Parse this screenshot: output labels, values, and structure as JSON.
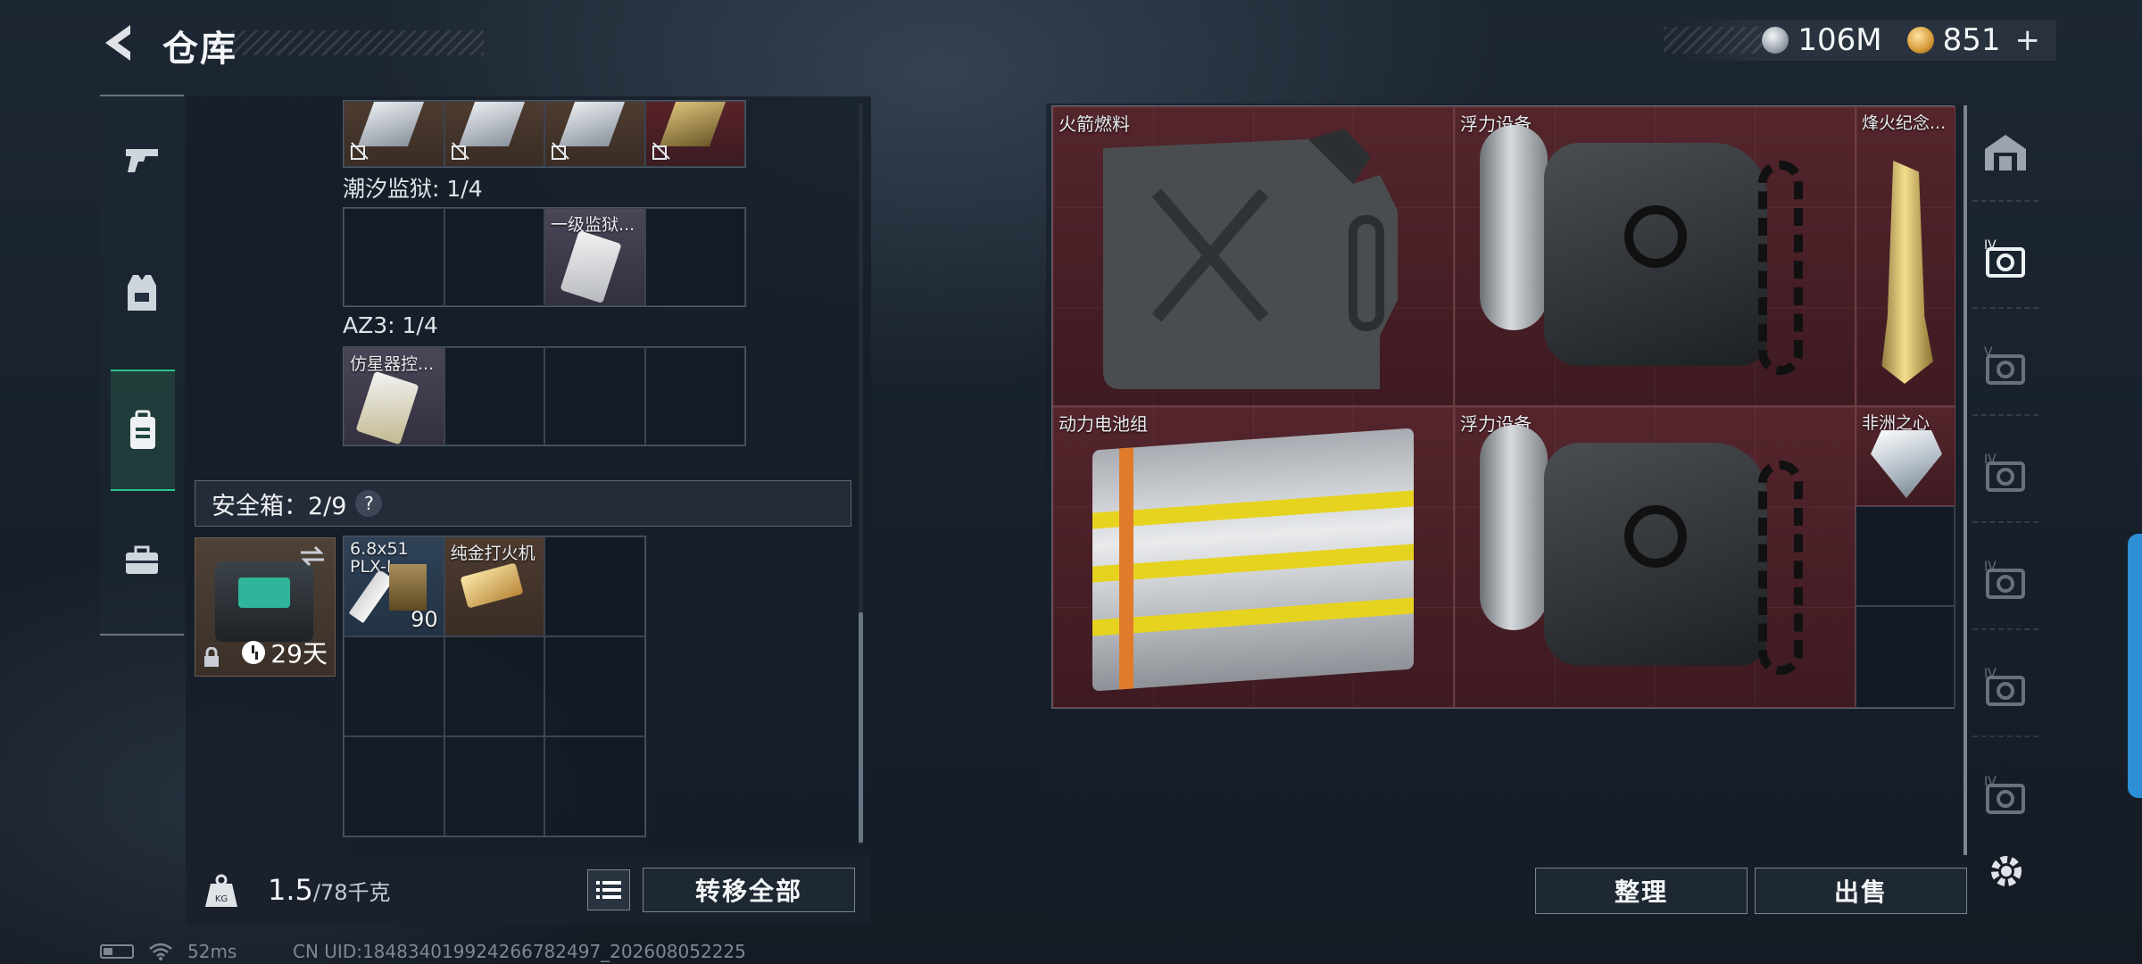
{
  "header": {
    "title": "仓库",
    "currency": [
      {
        "icon": "silver-coin-icon",
        "value": "106M"
      },
      {
        "icon": "gold-coin-icon",
        "value": "851"
      }
    ],
    "currency_plus": "+"
  },
  "left_rail": {
    "items": [
      {
        "name": "weapons",
        "icon": "pistol-icon"
      },
      {
        "name": "gear",
        "icon": "vest-icon"
      },
      {
        "name": "backpack",
        "icon": "backpack-icon",
        "active": true
      },
      {
        "name": "case",
        "icon": "briefcase-icon"
      }
    ]
  },
  "inventory": {
    "top_row_cells": [
      "no-drop-icon",
      "no-drop-icon",
      "no-drop-icon",
      "no-drop-icon"
    ],
    "sections": [
      {
        "label": "潮汐监狱: 1/4",
        "slots": [
          "",
          "",
          "一级监狱...",
          ""
        ]
      },
      {
        "label": "AZ3: 1/4",
        "slots": [
          "仿星器控...",
          "",
          "",
          ""
        ]
      }
    ],
    "safe": {
      "label": "安全箱：2/9",
      "help": "?",
      "days": "29天",
      "items": [
        {
          "label": "6.8x51\nPLX-L",
          "count": "90"
        },
        {
          "label": "纯金打火机"
        }
      ]
    },
    "weight": {
      "current": "1.5",
      "max": "/78千克"
    },
    "transfer_all": "转移全部"
  },
  "stash": {
    "items": [
      {
        "label": "火箭燃料"
      },
      {
        "label": "浮力设备"
      },
      {
        "label": "烽火纪念..."
      },
      {
        "label": "动力电池组"
      },
      {
        "label": "浮力设备"
      },
      {
        "label": "非洲之心"
      }
    ],
    "sort": "整理",
    "sell": "出售",
    "rail_labels": [
      "IV",
      "V",
      "IV",
      "IV",
      "IV",
      "IV"
    ]
  },
  "status": {
    "ping": "52ms",
    "uid": "CN UID:18483401992426678249​7_202608052225"
  },
  "colors": {
    "accent_green": "#29c48b",
    "item_red": "#4e2228",
    "blue_tab": "#2d8fd6"
  }
}
